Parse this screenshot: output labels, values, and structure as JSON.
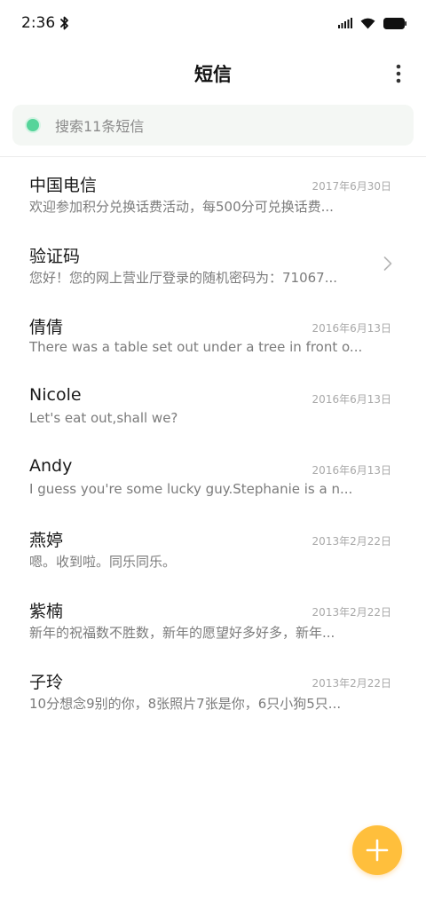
{
  "status_bar": {
    "time": "2:36",
    "icons": [
      "bluetooth-icon",
      "signal-icon",
      "wifi-icon",
      "battery-icon"
    ]
  },
  "header": {
    "title": "短信",
    "more_icon": "more-vertical-icon"
  },
  "search": {
    "placeholder": "搜索11条短信",
    "accent": "#56d49a",
    "background": "#f4f7f4"
  },
  "messages": [
    {
      "name": "中国电信",
      "date": "2017年6月30日",
      "preview": "欢迎参加积分兑换话费活动，每500分可兑换话费..."
    },
    {
      "name": "验证码",
      "date": "",
      "preview": "您好！您的网上营业厅登录的随机密码为：71067..."
    },
    {
      "name": "倩倩",
      "date": "2016年6月13日",
      "preview": "There was a table set out under a tree in front o..."
    },
    {
      "name": "Nicole",
      "date": "2016年6月13日",
      "preview": "Let's eat out,shall we?"
    },
    {
      "name": "Andy",
      "date": "2016年6月13日",
      "preview": "I guess you're some lucky guy.Stephanie is a n..."
    },
    {
      "name": "燕婷",
      "date": "2013年2月22日",
      "preview": "嗯。收到啦。同乐同乐。"
    },
    {
      "name": "紫楠",
      "date": "2013年2月22日",
      "preview": "新年的祝福数不胜数，新年的愿望好多好多，新年..."
    },
    {
      "name": "子玲",
      "date": "2013年2月22日",
      "preview": "10分想念9别的你，8张照片7张是你，6只小狗5只..."
    }
  ],
  "fab": {
    "icon": "plus-icon",
    "color": "#ffbf3c"
  }
}
